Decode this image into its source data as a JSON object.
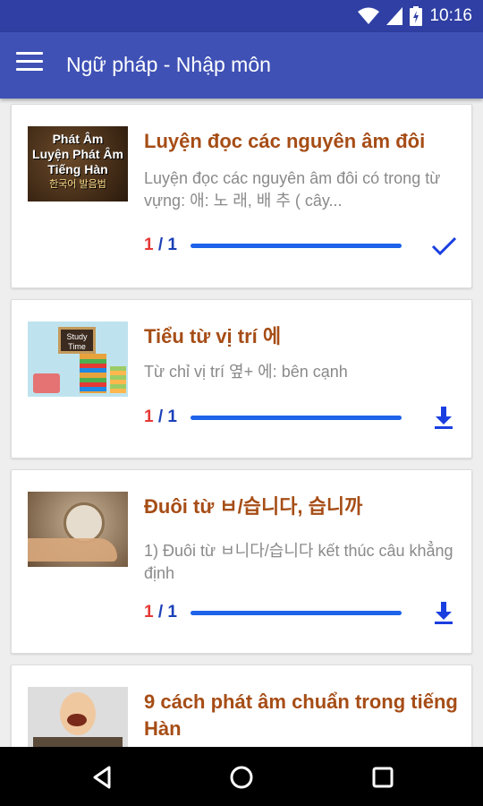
{
  "status_bar": {
    "time": "10:16"
  },
  "app_bar": {
    "title": "Ngữ pháp - Nhập môn"
  },
  "lessons": [
    {
      "thumb_lines": [
        "Phát Âm",
        "Luyện Phát Âm",
        "Tiếng Hàn",
        "한국어 발음법"
      ],
      "title": "Luyện đọc các nguyên âm đôi",
      "description": "Luyện đọc các nguyên âm đôi có trong từ vựng:  애: 노 래, 배 추 ( cây...",
      "progress_current": "1",
      "progress_sep": " / ",
      "progress_total": "1",
      "progress_fraction": 1.0,
      "status": "completed",
      "icon": "check-icon"
    },
    {
      "thumb_lines": [
        "Study",
        "Time"
      ],
      "title": "Tiểu từ vị trí 에",
      "description": "Từ chỉ vị trí 옆+ 에: bên cạnh",
      "progress_current": "1",
      "progress_sep": " / ",
      "progress_total": "1",
      "progress_fraction": 1.0,
      "status": "download",
      "icon": "download-icon"
    },
    {
      "title": "Đuôi từ ㅂ/습니다, 습니까",
      "description": "1) Đuôi từ ㅂ니다/습니다 kết thúc câu khẳng định",
      "progress_current": "1",
      "progress_sep": " / ",
      "progress_total": "1",
      "progress_fraction": 1.0,
      "status": "download",
      "icon": "download-icon"
    },
    {
      "title": "9 cách phát âm chuẩn trong tiếng Hàn"
    }
  ],
  "colors": {
    "status_bar": "#2f3fa3",
    "app_bar": "#3f51b5",
    "title_text": "#a64d16",
    "progress_fill": "#1e63e9",
    "progress_current": "#e53935",
    "action_icon": "#1a3fe0"
  }
}
